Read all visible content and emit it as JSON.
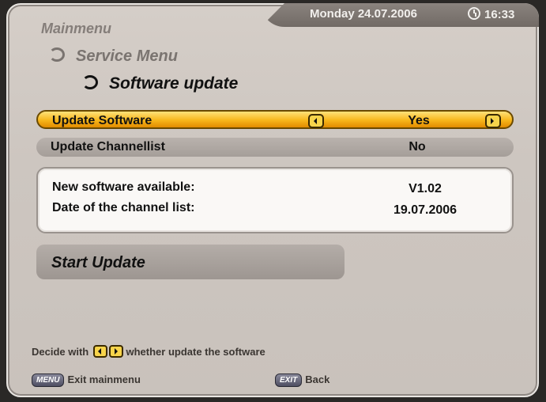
{
  "header": {
    "date": "Monday 24.07.2006",
    "time": "16:33",
    "clock_icon": "clock-icon"
  },
  "breadcrumb": {
    "level1": "Mainmenu",
    "level2": "Service Menu",
    "level3": "Software update"
  },
  "settings": [
    {
      "label": "Update Software",
      "value": "Yes",
      "selected": true
    },
    {
      "label": "Update Channellist",
      "value": "No",
      "selected": false
    }
  ],
  "info": {
    "new_software_label": "New software available:",
    "new_software_value": "V1.02",
    "channel_list_label": "Date of the channel list:",
    "channel_list_value": "19.07.2006"
  },
  "start_button": "Start Update",
  "hint": {
    "prefix": "Decide with",
    "suffix": "whether update the software"
  },
  "footer": {
    "menu_key": "MENU",
    "menu_label": "Exit mainmenu",
    "exit_key": "EXIT",
    "exit_label": "Back"
  },
  "colors": {
    "highlight": "#f7b61a",
    "background": "#cdc6c0",
    "infobox": "#faf8f6"
  }
}
